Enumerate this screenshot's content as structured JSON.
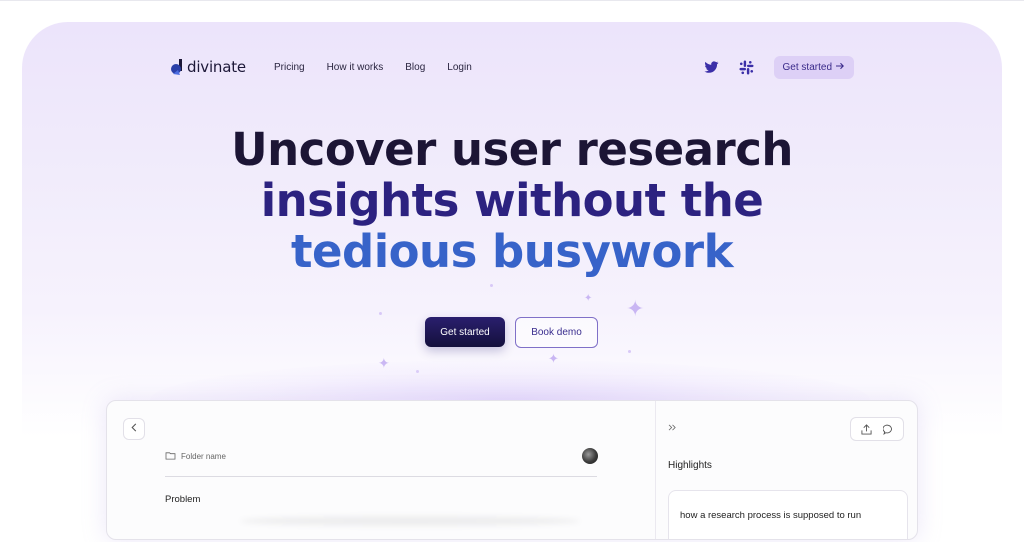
{
  "nav": {
    "logo_text": "divinate",
    "links": [
      "Pricing",
      "How it works",
      "Blog",
      "Login"
    ],
    "social": [
      "twitter-icon",
      "slack-icon"
    ],
    "cta_label": "Get started",
    "cta_icon": "arrow-right-icon"
  },
  "hero": {
    "line1": "Uncover user research",
    "line2": "insights without the",
    "line3": "tedious busywork",
    "primary_button": "Get started",
    "secondary_button": "Book demo"
  },
  "app_preview": {
    "back_icon": "chevron-left-icon",
    "folder_name": "Folder name",
    "section_label": "Problem",
    "expand_icon": "double-chevron-right-icon",
    "share_icon": "share-icon",
    "comment_icon": "comment-icon",
    "highlights_label": "Highlights",
    "highlight_text": "how a research process is supposed to run"
  },
  "colors": {
    "hero_line1": "#1c1535",
    "hero_line2": "#2c2280",
    "hero_line3": "#3763c9",
    "accent": "#ddd0f6",
    "primary_button": "#1c1650"
  }
}
